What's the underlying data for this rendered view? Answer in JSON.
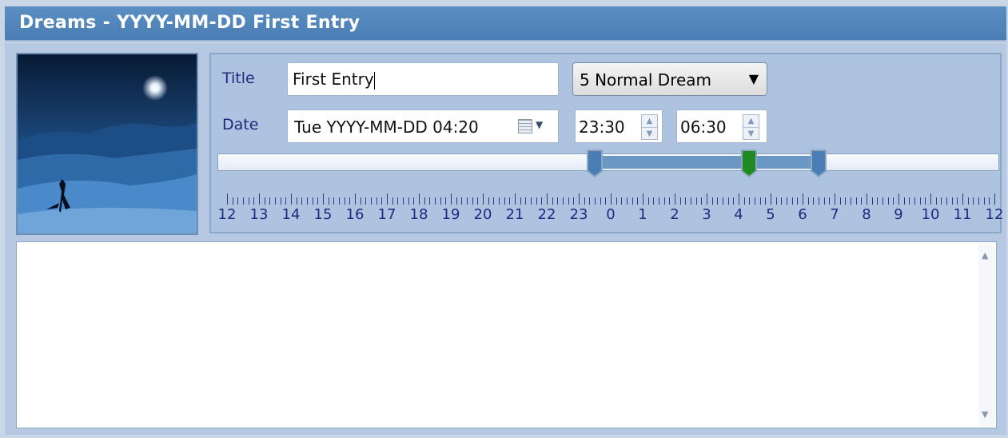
{
  "window": {
    "title": "Dreams - YYYY-MM-DD First Entry"
  },
  "form": {
    "title_label": "Title",
    "title_value": "First Entry",
    "dream_type": "5 Normal Dream",
    "date_label": "Date",
    "date_value": "Tue YYYY-MM-DD 04:20",
    "start_time": "23:30",
    "end_time": "06:30"
  },
  "timeline": {
    "hour_labels": [
      "12",
      "13",
      "14",
      "15",
      "16",
      "17",
      "18",
      "19",
      "20",
      "21",
      "22",
      "23",
      "0",
      "1",
      "2",
      "3",
      "4",
      "5",
      "6",
      "7",
      "8",
      "9",
      "10",
      "11",
      "12"
    ],
    "start_hour": "23:30",
    "event_hour": "04:20",
    "end_hour": "06:30",
    "colors": {
      "range": "#6a97c3",
      "start_thumb": "#4a7db3",
      "event_thumb": "#1f8a1f",
      "end_thumb": "#4a7db3"
    }
  },
  "notes": {
    "text": ""
  },
  "icons": {
    "calendar": "calendar-icon",
    "dropdown": "chevron-down-icon",
    "spin_up": "spin-up-icon",
    "spin_down": "spin-down-icon"
  }
}
